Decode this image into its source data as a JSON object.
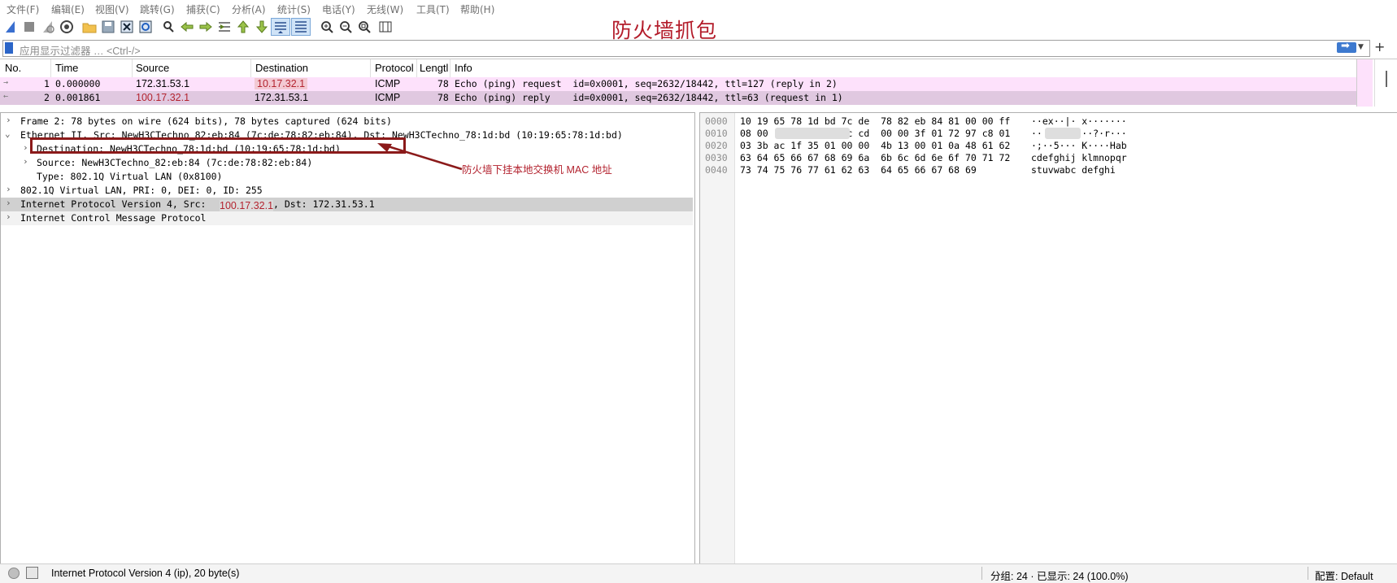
{
  "menu": [
    "文件(F)",
    "编辑(E)",
    "视图(V)",
    "跳转(G)",
    "捕获(C)",
    "分析(A)",
    "统计(S)",
    "电话(Y)",
    "无线(W)",
    "工具(T)",
    "帮助(H)"
  ],
  "toolbar_icons": [
    "shark-fin-start-icon",
    "stop-icon",
    "restart-icon",
    "capture-options-icon",
    "open-folder-icon",
    "save-icon",
    "close-file-icon",
    "reload-icon",
    "find-icon",
    "back-arrow-icon",
    "forward-arrow-icon",
    "go-to-packet-icon",
    "first-packet-icon",
    "last-packet-icon",
    "autoscroll-icon",
    "colorize-icon",
    "zoom-in-icon",
    "zoom-out-icon",
    "zoom-reset-icon",
    "resize-columns-icon"
  ],
  "overlay_title": "防火墙抓包",
  "filter": {
    "placeholder": "应用显示过滤器 … <Ctrl-/>"
  },
  "packet_list": {
    "columns": [
      "No.",
      "Time",
      "Source",
      "Destination",
      "Protocol",
      "Lengtl",
      "Info"
    ],
    "rows": [
      {
        "no": "1",
        "time": "0.000000",
        "source": "172.31.53.1",
        "destination": "10.17.32.1",
        "protocol": "ICMP",
        "length": "78",
        "info": "Echo (ping) request  id=0x0001, seq=2632/18442, ttl=127 (reply in 2)",
        "bg": "#fde1fb"
      },
      {
        "no": "2",
        "time": "0.001861",
        "source": "100.17.32.1",
        "destination": "172.31.53.1",
        "protocol": "ICMP",
        "length": "78",
        "info": "Echo (ping) reply    id=0x0001, seq=2632/18442, ttl=63 (request in 1)",
        "bg": "#e0c8e0"
      }
    ]
  },
  "details": {
    "frame": "Frame 2: 78 bytes on wire (624 bits), 78 bytes captured (624 bits)",
    "ethernet": "Ethernet II, Src: NewH3CTechno_82:eb:84 (7c:de:78:82:eb:84), Dst: NewH3CTechno_78:1d:bd (10:19:65:78:1d:bd)",
    "eth_destination": "Destination: NewH3CTechno_78:1d:bd (10:19:65:78:1d:bd)",
    "eth_source": "Source: NewH3CTechno_82:eb:84 (7c:de:78:82:eb:84)",
    "eth_type": "Type: 802.1Q Virtual LAN (0x8100)",
    "vlan": "802.1Q Virtual LAN, PRI: 0, DEI: 0, ID: 255",
    "ipv4_prefix": "Internet Protocol Version 4, Src:",
    "ipv4_src": "100.17.32.1",
    "ipv4_suffix": ", Dst: 172.31.53.1",
    "icmp": "Internet Control Message Protocol",
    "annotation": "防火墙下挂本地交换机 MAC 地址"
  },
  "bytes": {
    "offsets": [
      "0000",
      "0010",
      "0020",
      "0030",
      "0040"
    ],
    "hex": [
      "10 19 65 78 1d bd 7c de  78 82 eb 84 81 00 00 ff",
      "08 00             6c cd  00 00 3f 01 72 97 c8 01",
      "03 3b ac 1f 35 01 00 00  4b 13 00 01 0a 48 61 62",
      "63 64 65 66 67 68 69 6a  6b 6c 6d 6e 6f 70 71 72",
      "73 74 75 76 77 61 62 63  64 65 66 67 68 69"
    ],
    "ascii": [
      "··ex··|· x·······",
      "··       ··?·r···",
      "·;··5··· K····Hab",
      "cdefghij klmnopqr",
      "stuvwabc defghi"
    ]
  },
  "status": {
    "left": "Internet Protocol Version 4 (ip), 20 byte(s)",
    "middle": "分组: 24 · 已显示: 24 (100.0%)",
    "right": "配置: Default"
  }
}
